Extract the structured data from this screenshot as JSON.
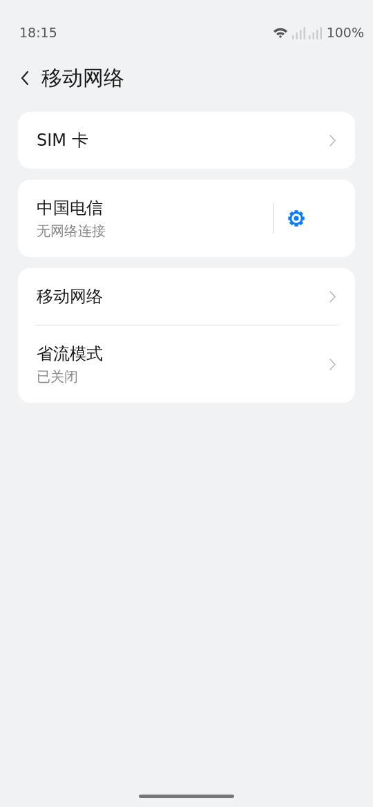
{
  "status_bar": {
    "time": "18:15",
    "battery": "100%"
  },
  "header": {
    "title": "移动网络"
  },
  "cards": [
    {
      "items": [
        {
          "title": "SIM 卡",
          "kind": "chevron"
        }
      ]
    },
    {
      "items": [
        {
          "title": "中国电信",
          "subtitle": "无网络连接",
          "kind": "gear"
        }
      ]
    },
    {
      "items": [
        {
          "title": "移动网络",
          "kind": "chevron"
        },
        {
          "title": "省流模式",
          "subtitle": "已关闭",
          "kind": "chevron"
        }
      ]
    }
  ]
}
